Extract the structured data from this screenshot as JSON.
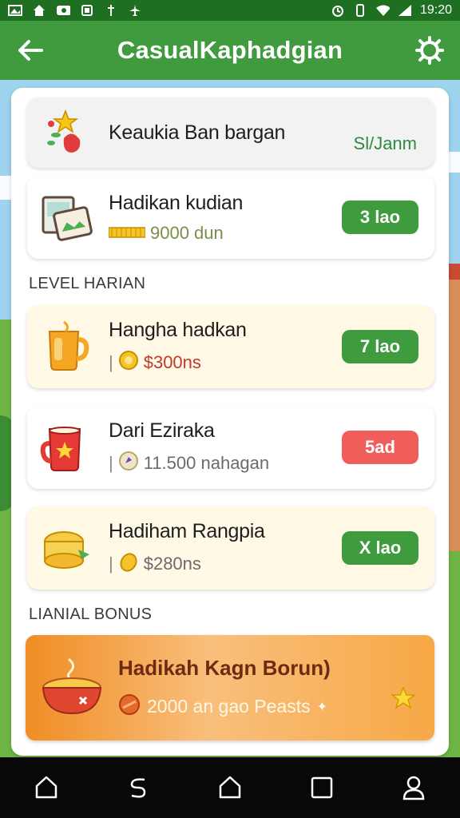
{
  "status_bar": {
    "time": "19:20"
  },
  "app_bar": {
    "title": "CasualKaphadgian"
  },
  "top_card": {
    "title": "Keaukia Ban bargan",
    "link_text": "Sl/Janm"
  },
  "reward_card": {
    "title": "Hadikan kudian",
    "amount": "9000 dun",
    "button": "3 lao"
  },
  "section_daily": {
    "label": "LEVEL HARIAN"
  },
  "daily_items": [
    {
      "title": "Hangha hadkan",
      "amount": "$300ns",
      "button": "7 lao",
      "button_color": "#3e9b3e",
      "amount_color": "#c0392b"
    },
    {
      "title": "Dari Ezirakа",
      "amount": "11.500 nahagan",
      "button": "5ad",
      "button_color": "#ef5e5a",
      "amount_color": "#6b6b6b"
    },
    {
      "title": "Hadiham Rangpia",
      "amount": "$280ns",
      "button": "X lao",
      "button_color": "#3e9b3e",
      "amount_color": "#6b6b6b"
    }
  ],
  "section_bonus": {
    "label": "LIANIAL BONUS"
  },
  "bonus_card": {
    "title": "Hadikah Kagn Borun)",
    "subtitle": "2000 an gao Peasts"
  },
  "colors": {
    "primary_green": "#3f9b3d",
    "status_green": "#1f6f22",
    "accent_orange": "#f08d24"
  }
}
